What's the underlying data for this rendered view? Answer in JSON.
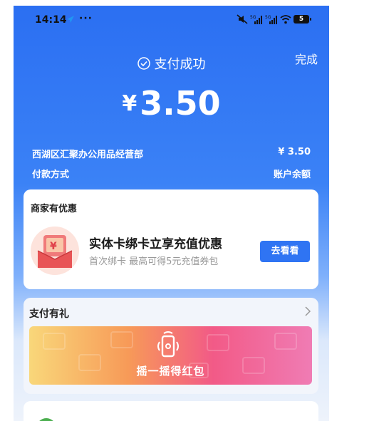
{
  "status_bar": {
    "time": "14:14",
    "more": "···",
    "battery": "5"
  },
  "header": {
    "done_label": "完成",
    "success_text": "支付成功",
    "currency_symbol": "¥",
    "amount": "3.50"
  },
  "payment_info": {
    "merchant_name": "西湖区汇聚办公用品经营部",
    "merchant_amount": "¥ 3.50",
    "method_label": "付款方式",
    "method_value": "账户余额"
  },
  "merchant_offer": {
    "section_title": "商家有优惠",
    "promo_title": "实体卡绑卡立享充值优惠",
    "promo_subtitle": "首次绑卡 最高可得5元充值券包",
    "button_label": "去看看"
  },
  "payment_gift": {
    "section_title": "支付有礼",
    "banner_text": "摇一摇得红包"
  },
  "colors": {
    "primary_blue": "#2f74f3",
    "header_blue": "#2b6ff2"
  }
}
